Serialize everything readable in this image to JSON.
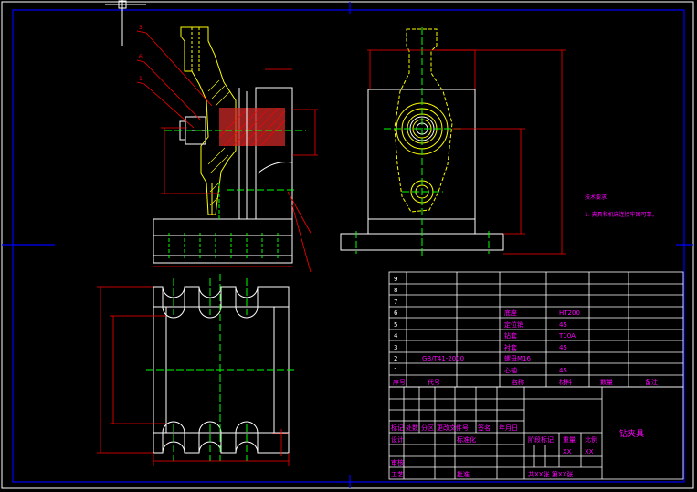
{
  "colors": {
    "background": "#000000",
    "frame": "#ffffff",
    "border_blue": "#0000ff",
    "part_yellow": "#ffff00",
    "dimension_red": "#ff0000",
    "centerline_green": "#00ff00",
    "text_magenta": "#ff00ff",
    "hatch_red": "#cc2a2a"
  },
  "cursor_icon": "crosshair-icon",
  "notes": {
    "heading": "技术要求",
    "line1": "1. 夹具和机床连接牢固可靠。"
  },
  "bom": {
    "rows": [
      {
        "no": "9",
        "code": "",
        "name": "",
        "material": "",
        "remark": ""
      },
      {
        "no": "8",
        "code": "",
        "name": "",
        "material": "",
        "remark": ""
      },
      {
        "no": "7",
        "code": "",
        "name": "",
        "material": "",
        "remark": ""
      },
      {
        "no": "6",
        "code": "",
        "name": "底座",
        "material": "HT200",
        "remark": ""
      },
      {
        "no": "5",
        "code": "",
        "name": "定位销",
        "material": "45",
        "remark": ""
      },
      {
        "no": "4",
        "code": "",
        "name": "钻套",
        "material": "T10A",
        "remark": ""
      },
      {
        "no": "3",
        "code": "",
        "name": "衬套",
        "material": "45",
        "remark": ""
      },
      {
        "no": "2",
        "code": "GB/T41-2000",
        "name": "螺母M16",
        "material": "",
        "remark": ""
      },
      {
        "no": "1",
        "code": "",
        "name": "心轴",
        "material": "45",
        "remark": ""
      }
    ],
    "header": {
      "no": "序号",
      "code": "代号",
      "name": "名称",
      "material": "材料",
      "qty": "数量",
      "remark": "备注"
    }
  },
  "title_block": {
    "drawing_name": "钻夹具",
    "mark_labels": [
      "标记",
      "处数",
      "分区",
      "更改文件号",
      "签名",
      "年月日"
    ],
    "design": "设计",
    "standardize": "标准化",
    "stage_mark": "阶段标记",
    "weight": "重量",
    "scale": "比例",
    "weight_value": "XX",
    "scale_value": "XX",
    "review": "审核",
    "process": "工艺",
    "approve": "批准",
    "sheets": "共XX张 第XX张"
  },
  "balloons": [
    "3",
    "6",
    "1"
  ]
}
